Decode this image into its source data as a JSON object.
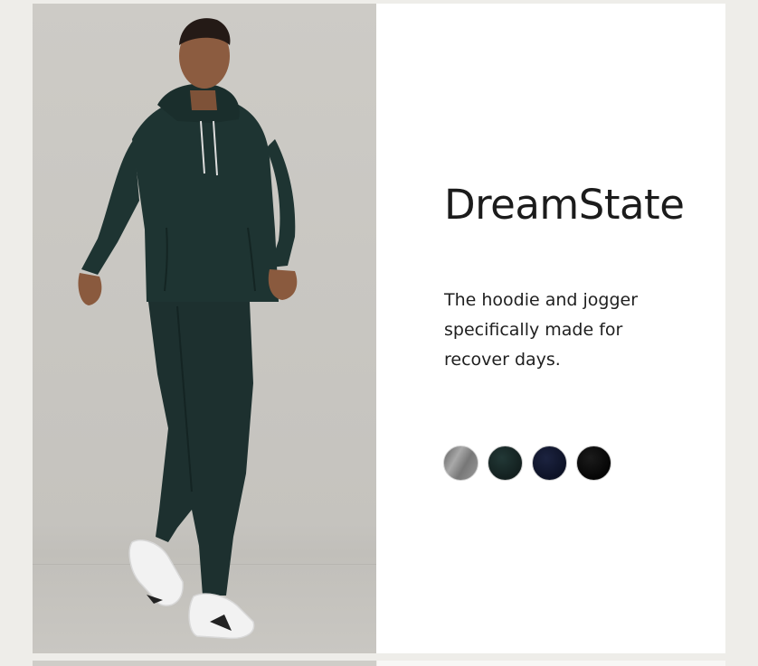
{
  "product": {
    "title": "DreamState",
    "description": "The hoodie and jogger specifically made for recover days."
  },
  "photo": {
    "subject": "model wearing dark green hoodie and jogger set with white sneakers"
  },
  "swatches": [
    {
      "name": "heather-grey",
      "color": "#8e8e8e"
    },
    {
      "name": "dark-green",
      "color": "#16292a"
    },
    {
      "name": "navy",
      "color": "#121830"
    },
    {
      "name": "black",
      "color": "#0b0b0b"
    }
  ],
  "colors": {
    "background": "#eeede9",
    "card": "#ffffff",
    "photo_bg": "#c8c6c1",
    "text": "#1b1b1b"
  }
}
